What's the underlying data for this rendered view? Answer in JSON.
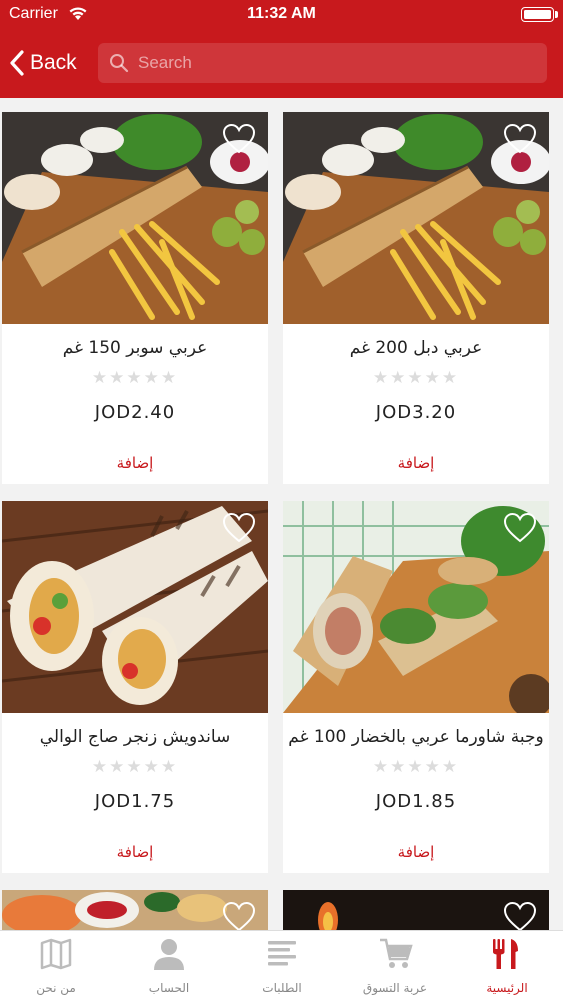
{
  "status_bar": {
    "carrier": "Carrier",
    "time": "11:32 AM"
  },
  "header": {
    "back_label": "Back",
    "search_placeholder": "Search"
  },
  "colors": {
    "primary": "#c8191d",
    "background": "#f2f2f2"
  },
  "products": [
    {
      "name": "عربي دبل 200 غم",
      "price": "JOD3.20",
      "add_label": "إضافة",
      "rating": 0,
      "favorite": false
    },
    {
      "name": "عربي سوبر 150 غم",
      "price": "JOD2.40",
      "add_label": "إضافة",
      "rating": 0,
      "favorite": false
    },
    {
      "name": "وجبة شاورما عربي بالخضار 100 غم",
      "price": "JOD1.85",
      "add_label": "إضافة",
      "rating": 0,
      "favorite": false
    },
    {
      "name": "ساندويش زنجر صاج الوالي",
      "price": "JOD1.75",
      "add_label": "إضافة",
      "rating": 0,
      "favorite": false
    }
  ],
  "tabs": [
    {
      "label": "الرئيسية",
      "icon": "fork-knife-icon",
      "active": true
    },
    {
      "label": "عربة التسوق",
      "icon": "cart-icon",
      "active": false
    },
    {
      "label": "الطلبات",
      "icon": "list-icon",
      "active": false
    },
    {
      "label": "الحساب",
      "icon": "user-icon",
      "active": false
    },
    {
      "label": "من نحن",
      "icon": "map-icon",
      "active": false
    }
  ]
}
